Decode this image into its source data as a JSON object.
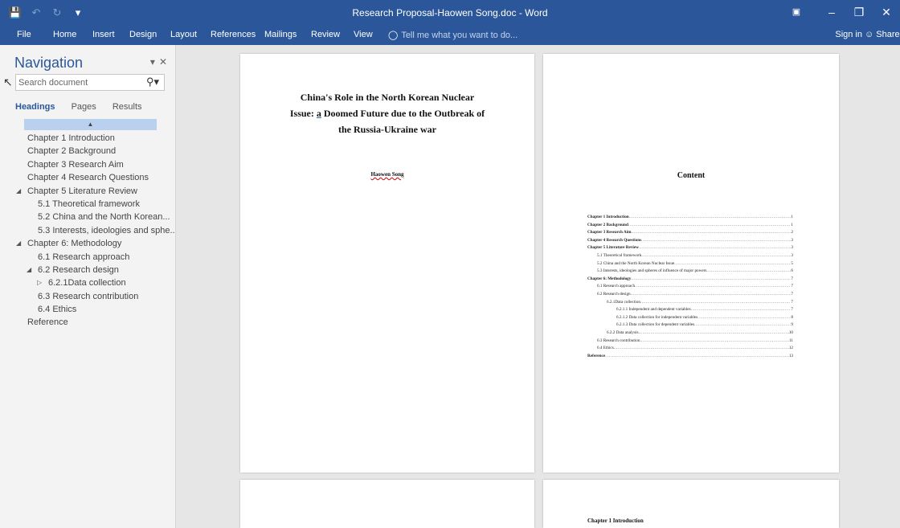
{
  "window": {
    "title": "Research Proposal-Haowen Song.doc - Word"
  },
  "ribbon": {
    "tabs": [
      "File",
      "Home",
      "Insert",
      "Design",
      "Layout",
      "References",
      "Mailings",
      "Review",
      "View"
    ],
    "tell_me_placeholder": "Tell me what you want to do...",
    "sign_in": "Sign in",
    "share": "Share"
  },
  "navigation": {
    "title": "Navigation",
    "search_placeholder": "Search document",
    "tabs": [
      "Headings",
      "Pages",
      "Results"
    ],
    "active_tab": "Headings",
    "headings": [
      {
        "label": "Chapter 1 Introduction",
        "level": 1
      },
      {
        "label": "Chapter 2 Background",
        "level": 1
      },
      {
        "label": "Chapter 3 Research Aim",
        "level": 1
      },
      {
        "label": "Chapter 4 Research Questions",
        "level": 1
      },
      {
        "label": "Chapter 5 Literature Review",
        "level": 1,
        "expanded": true
      },
      {
        "label": "5.1 Theoretical framework",
        "level": 2
      },
      {
        "label": "5.2 China and the North Korean...",
        "level": 2
      },
      {
        "label": "5.3 Interests, ideologies and sphe...",
        "level": 2
      },
      {
        "label": "Chapter 6: Methodology",
        "level": 1,
        "expanded": true
      },
      {
        "label": "6.1 Research approach",
        "level": 2
      },
      {
        "label": "6.2 Research design",
        "level": 2,
        "expanded": true
      },
      {
        "label": "6.2.1Data collection",
        "level": 3,
        "collapsed": true
      },
      {
        "label": "6.3 Research contribution",
        "level": 2
      },
      {
        "label": "6.4 Ethics",
        "level": 2
      },
      {
        "label": "Reference",
        "level": 1
      }
    ]
  },
  "document": {
    "cover": {
      "title_line1": "China's Role in the North Korean Nuclear",
      "title_line2_pre": "Issue: ",
      "title_line2_a": "a",
      "title_line2_post": " Doomed Future due to the Outbreak of",
      "title_line3": "the Russia-Ukraine war",
      "author": "Haowen Song"
    },
    "toc": {
      "title": "Content",
      "entries": [
        {
          "text": "Chapter 1 Introduction",
          "page": "1",
          "level": 1
        },
        {
          "text": "Chapter 2 Background",
          "page": "1",
          "level": 1
        },
        {
          "text": "Chapter 3 Research Aim",
          "page": "2",
          "level": 1
        },
        {
          "text": "Chapter 4 Research Questions",
          "page": "3",
          "level": 1
        },
        {
          "text": "Chapter 5 Literature Review",
          "page": "3",
          "level": 1
        },
        {
          "text": "5.1 Theoretical framework",
          "page": "3",
          "level": 2
        },
        {
          "text": "5.2 China and the North Korean Nuclear Issue",
          "page": "5",
          "level": 2
        },
        {
          "text": "5.3 Interests, ideologies and spheres of influence of major powers",
          "page": "6",
          "level": 2
        },
        {
          "text": "Chapter 6: Methodology",
          "page": "7",
          "level": 1
        },
        {
          "text": "6.1 Research approach",
          "page": "7",
          "level": 2
        },
        {
          "text": "6.2 Research design",
          "page": "7",
          "level": 2
        },
        {
          "text": "6.2.1Data collection",
          "page": "7",
          "level": 3
        },
        {
          "text": "6.2.1.1 Independent and dependent variables",
          "page": "7",
          "level": 4
        },
        {
          "text": "6.2.1.2 Data collection for independent variables",
          "page": "8",
          "level": 4
        },
        {
          "text": "6.2.1.3 Data collection for dependent variables",
          "page": "9",
          "level": 4
        },
        {
          "text": "6.2.2 Data analysis",
          "page": "10",
          "level": 3
        },
        {
          "text": "6.3 Research contribution",
          "page": "11",
          "level": 2
        },
        {
          "text": "6.4 Ethics",
          "page": "12",
          "level": 2
        },
        {
          "text": "Reference",
          "page": "13",
          "level": 1
        }
      ]
    },
    "page3_heading": "Chapter 1 Introduction"
  }
}
